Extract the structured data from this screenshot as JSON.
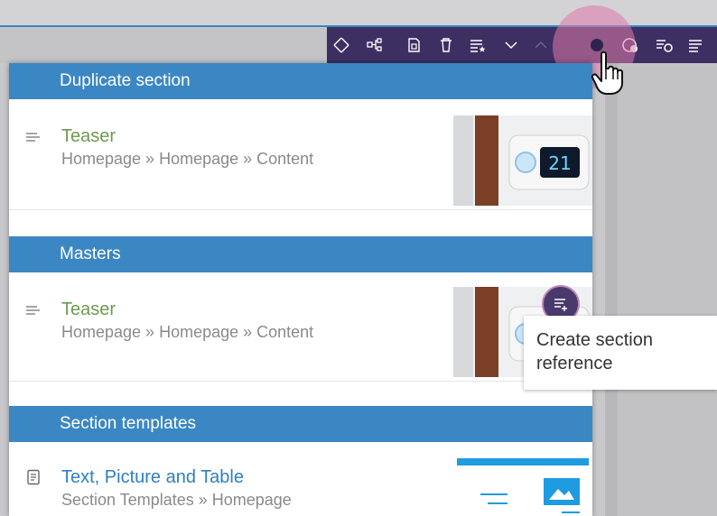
{
  "toolbar": {
    "icons": [
      "move-icon",
      "structure-icon",
      "page-icon",
      "delete-icon",
      "list-star-icon",
      "chevron-down-icon",
      "chevron-up-icon",
      "section-reference-icon",
      "copy-icon",
      "refresh-list-icon",
      "list-icon"
    ]
  },
  "sections": [
    {
      "header": "Duplicate section",
      "items": [
        {
          "title": "Teaser",
          "path": "Homepage » Homepage » Content",
          "thumb_value": "21",
          "title_color": "#6f9a4f"
        }
      ]
    },
    {
      "header": "Masters",
      "items": [
        {
          "title": "Teaser",
          "path": "Homepage » Homepage » Content",
          "title_color": "#6f9a4f"
        }
      ]
    },
    {
      "header": "Section templates",
      "items": [
        {
          "title": "Text, Picture and Table",
          "path": "Section Templates » Homepage",
          "title_color": "#2f7fc1"
        }
      ]
    }
  ],
  "tooltip": {
    "text_line1": "Create section",
    "text_line2": "reference"
  },
  "colors": {
    "toolbar": "#3e2f63",
    "header": "#3b87c4",
    "accent_pink": "#de78aa"
  }
}
